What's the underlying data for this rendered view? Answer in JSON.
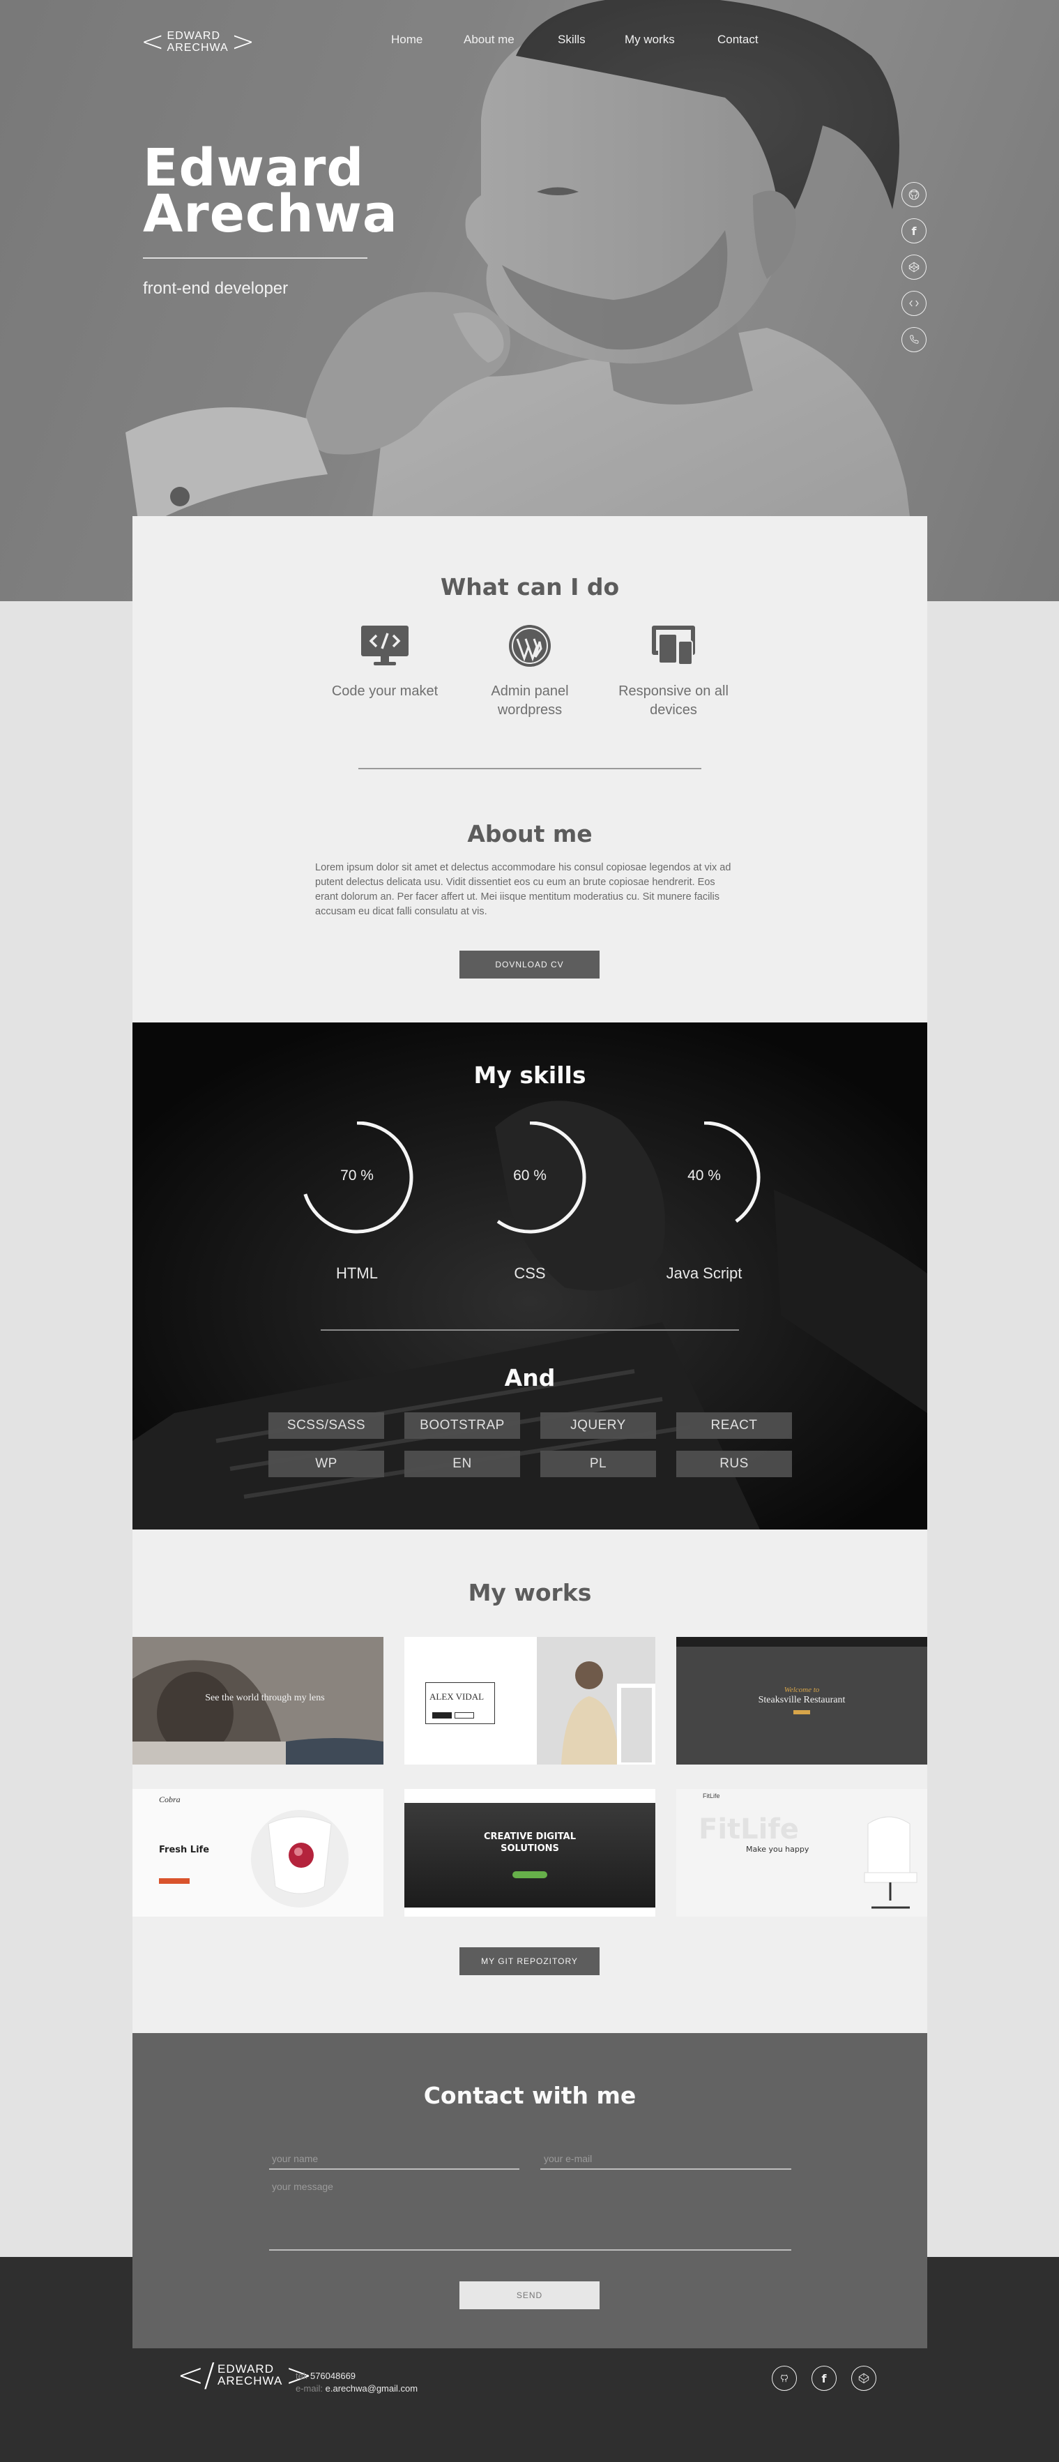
{
  "header": {
    "logo_top": "EDWARD",
    "logo_bottom": "ARECHWA",
    "nav": [
      "Home",
      "About me",
      "Skills",
      "My works",
      "Contact"
    ]
  },
  "hero": {
    "name_line1": "Edward",
    "name_line2": "Arechwa",
    "subtitle": "front-end developer",
    "social_icons": [
      "github-icon",
      "facebook-icon",
      "codepen-icon",
      "github-icon",
      "phone-icon"
    ]
  },
  "services": {
    "title": "What can I do",
    "items": [
      {
        "icon": "code-monitor-icon",
        "label": "Code your maket"
      },
      {
        "icon": "wordpress-icon",
        "label": "Admin panel wordpress"
      },
      {
        "icon": "responsive-devices-icon",
        "label": "Responsive on all devices"
      }
    ]
  },
  "about": {
    "title": "About me",
    "text": "Lorem ipsum dolor sit amet et delectus accommodare his consul copiosae legendos at vix ad putent delectus delicata usu. Vidit dissentiet eos cu eum an brute copiosae hendrerit. Eos erant dolorum an. Per facer affert ut. Mei iisque mentitum moderatius cu. Sit munere facilis accusam eu dicat falli consulatu at vis.",
    "button": "DOVNLOAD CV"
  },
  "skills": {
    "title": "My skills",
    "items": [
      {
        "name": "HTML",
        "value_label": "70 %",
        "percent": 70
      },
      {
        "name": "CSS",
        "value_label": "60 %",
        "percent": 60
      },
      {
        "name": "Java Script",
        "value_label": "40 %",
        "percent": 40
      }
    ],
    "and_title": "And",
    "tags": [
      "SCSS/SASS",
      "BOOTSTRAP",
      "JQUERY",
      "REACT",
      "WP",
      "EN",
      "PL",
      "RUS"
    ]
  },
  "works": {
    "title": "My works",
    "items": [
      {
        "headline": "See the world through my lens"
      },
      {
        "headline": "ALEX VIDAL"
      },
      {
        "headline": "Steaksville Restaurant",
        "kicker": "Welcome to"
      },
      {
        "headline": "Fresh Life",
        "brand": "Cobra"
      },
      {
        "headline": "CREATIVE DIGITAL SOLUTIONS"
      },
      {
        "headline": "Make you happy",
        "brand": "FitLife",
        "watermark": "FitLife"
      }
    ],
    "button": "MY GIT REPOZITORY"
  },
  "contact": {
    "title": "Contact with me",
    "name_placeholder": "your name",
    "email_placeholder": "your e-mail",
    "message_placeholder": "your message",
    "button": "SEND"
  },
  "footer": {
    "tel_label": "tel:",
    "tel": "576048669",
    "email_label": "e-mail:",
    "email": "e.arechwa@gmail.com",
    "icons": [
      "github-icon",
      "facebook-icon",
      "codepen-icon"
    ]
  }
}
